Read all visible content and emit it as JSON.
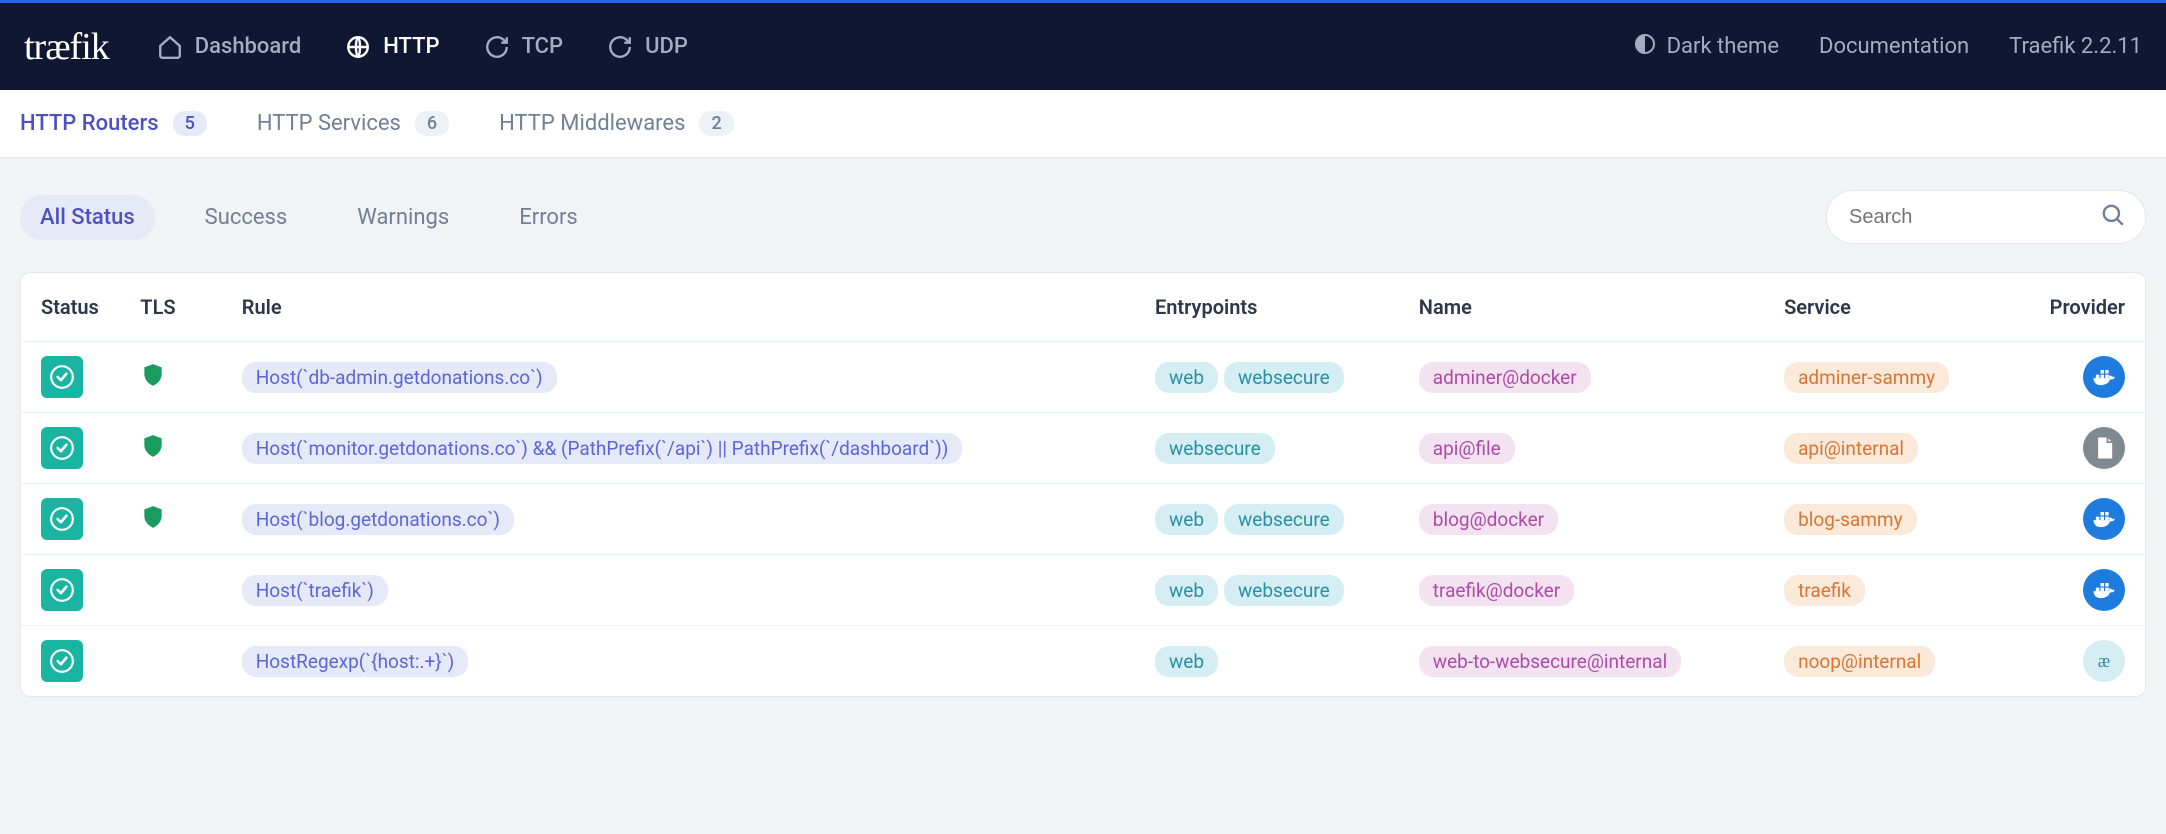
{
  "header": {
    "logo": "træfik",
    "nav": [
      {
        "label": "Dashboard",
        "icon": "home",
        "active": false
      },
      {
        "label": "HTTP",
        "icon": "globe",
        "active": true
      },
      {
        "label": "TCP",
        "icon": "refresh",
        "active": false
      },
      {
        "label": "UDP",
        "icon": "refresh",
        "active": false
      }
    ],
    "right": {
      "theme": "Dark theme",
      "docs": "Documentation",
      "version": "Traefik 2.2.11"
    }
  },
  "subnav": [
    {
      "label": "HTTP Routers",
      "count": "5",
      "active": true
    },
    {
      "label": "HTTP Services",
      "count": "6",
      "active": false
    },
    {
      "label": "HTTP Middlewares",
      "count": "2",
      "active": false
    }
  ],
  "filters": [
    {
      "label": "All Status",
      "active": true
    },
    {
      "label": "Success",
      "active": false
    },
    {
      "label": "Warnings",
      "active": false
    },
    {
      "label": "Errors",
      "active": false
    }
  ],
  "search": {
    "placeholder": "Search"
  },
  "columns": {
    "status": "Status",
    "tls": "TLS",
    "rule": "Rule",
    "entrypoints": "Entrypoints",
    "name": "Name",
    "service": "Service",
    "provider": "Provider"
  },
  "rows": [
    {
      "tls": true,
      "rule": "Host(`db-admin.getdonations.co`)",
      "entrypoints": [
        "web",
        "websecure"
      ],
      "name": "adminer@docker",
      "service": "adminer-sammy",
      "provider": "docker"
    },
    {
      "tls": true,
      "rule": "Host(`monitor.getdonations.co`) && (PathPrefix(`/api`) || PathPrefix(`/dashboard`))",
      "entrypoints": [
        "websecure"
      ],
      "name": "api@file",
      "service": "api@internal",
      "provider": "file"
    },
    {
      "tls": true,
      "rule": "Host(`blog.getdonations.co`)",
      "entrypoints": [
        "web",
        "websecure"
      ],
      "name": "blog@docker",
      "service": "blog-sammy",
      "provider": "docker"
    },
    {
      "tls": false,
      "rule": "Host(`traefik`)",
      "entrypoints": [
        "web",
        "websecure"
      ],
      "name": "traefik@docker",
      "service": "traefik",
      "provider": "docker"
    },
    {
      "tls": false,
      "rule": "HostRegexp(`{host:.+}`)",
      "entrypoints": [
        "web"
      ],
      "name": "web-to-websecure@internal",
      "service": "noop@internal",
      "provider": "internal"
    }
  ]
}
